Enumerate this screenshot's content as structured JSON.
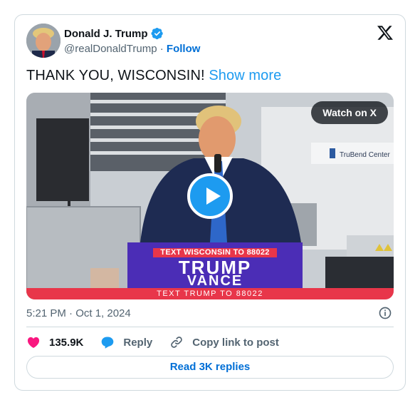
{
  "author": {
    "name": "Donald J. Trump",
    "handle": "@realDonaldTrump",
    "separator": "·",
    "follow_label": "Follow"
  },
  "tweet": {
    "text": "THANK YOU, WISCONSIN!",
    "show_more_label": "Show more",
    "timestamp": "5:21 PM · Oct 1, 2024"
  },
  "media": {
    "watch_label": "Watch on X",
    "sign_line1": "TEXT WISCONSIN TO 88022",
    "sign_line2": "TRUMP",
    "sign_line3": "VANCE",
    "banner_text": "TEXT TRUMP TO 88022",
    "background_sign": "TruBend Center"
  },
  "actions": {
    "likes_count": "135.9K",
    "reply_label": "Reply",
    "copy_label": "Copy link to post"
  },
  "read_replies_label": "Read 3K replies",
  "icons": [
    "verified-badge-icon",
    "x-logo-icon",
    "play-icon",
    "info-icon",
    "heart-icon",
    "reply-bubble-icon",
    "link-icon"
  ],
  "colors": {
    "accent": "#1d9bf0",
    "link": "#006fd6",
    "heart": "#f91880",
    "secondary_text": "#536471",
    "border": "#cfd9de"
  }
}
